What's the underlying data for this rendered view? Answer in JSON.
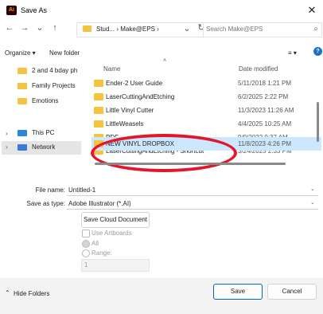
{
  "window": {
    "title": "Save As",
    "app_icon_text": "Ai"
  },
  "nav": {
    "back": "←",
    "forward": "→",
    "recent": "⌄",
    "up": "↑",
    "breadcrumb": "Stud... › Make@EPS ›",
    "dropdown": "⌄",
    "refresh": "↻",
    "search_placeholder": "Search Make@EPS",
    "search_icon": "⌕"
  },
  "toolbar": {
    "organize": "Organize ▾",
    "new_folder": "New folder",
    "view": "≡ ▾",
    "help": "?"
  },
  "sidebar": {
    "items": [
      {
        "label": "2 and 4 bday ph",
        "icon": "folder-icon"
      },
      {
        "label": "Family Projects",
        "icon": "folder-icon"
      },
      {
        "label": "Emotions",
        "icon": "folder-icon"
      },
      {
        "label": "This PC",
        "icon": "pc-icon"
      },
      {
        "label": "Network",
        "icon": "network-icon"
      }
    ]
  },
  "list": {
    "headers": {
      "name": "Name",
      "date": "Date modified"
    },
    "rows": [
      {
        "name": "Ender-2 User Guide",
        "date": "5/11/2018 1:21 PM"
      },
      {
        "name": "LaserCuttingAndEtching",
        "date": "6/2/2025 2:22 PM"
      },
      {
        "name": "Little Vinyl Cutter",
        "date": "11/3/2023 11:26 AM"
      },
      {
        "name": "LittleWeasels",
        "date": "4/4/2025 10:25 AM"
      },
      {
        "name": "PDF",
        "date": "9/9/2022 9:37 AM"
      },
      {
        "name": "LaserCuttingAndEtching - Shortcut",
        "date": "3/24/2025 2:33 PM"
      },
      {
        "name": "NEW VINYL DROPBOX",
        "date": "11/8/2023 4:26 PM"
      }
    ]
  },
  "form": {
    "file_name_label": "File name:",
    "file_name_value": "Untitled-1",
    "save_type_label": "Save as type:",
    "save_type_value": "Adobe Illustrator (*.AI)",
    "save_cloud": "Save Cloud Document",
    "use_artboards": "Use Artboards",
    "all": "All",
    "range": "Range:",
    "range_value": "1"
  },
  "footer": {
    "hide_folders": "Hide Folders",
    "save": "Save",
    "cancel": "Cancel"
  },
  "colors": {
    "selection": "#cce8ff",
    "annotation": "#e3162a",
    "folder": "#f5c242",
    "accent": "#1a73c7"
  }
}
